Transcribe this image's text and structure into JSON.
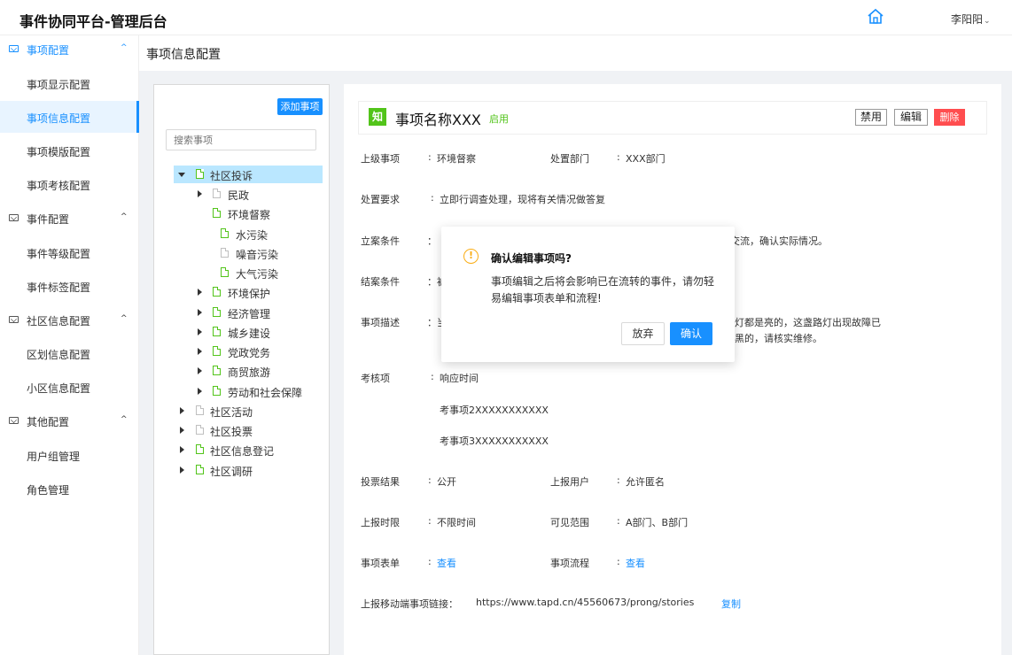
{
  "header": {
    "title": "事件协同平台-管理后台",
    "user": "李阳阳"
  },
  "sidebar": {
    "groups": [
      {
        "label": "事项配置",
        "items": [
          "事项显示配置",
          "事项信息配置",
          "事项模版配置",
          "事项考核配置"
        ]
      },
      {
        "label": "事件配置",
        "items": [
          "事件等级配置",
          "事件标签配置"
        ]
      },
      {
        "label": "社区信息配置",
        "items": [
          "区划信息配置",
          "小区信息配置"
        ]
      },
      {
        "label": "其他配置",
        "items": [
          "用户组管理",
          "角色管理"
        ]
      }
    ],
    "active_item": "事项信息配置"
  },
  "page": {
    "title": "事项信息配置"
  },
  "tree": {
    "add_button": "添加事项",
    "search_placeholder": "搜索事项",
    "nodes": [
      "社区投诉",
      "民政",
      "环境督察",
      "水污染",
      "噪音污染",
      "大气污染",
      "环境保护",
      "经济管理",
      "城乡建设",
      "党政党务",
      "商贸旅游",
      "劳动和社会保障",
      "社区活动",
      "社区投票",
      "社区信息登记",
      "社区调研"
    ]
  },
  "detail": {
    "badge": "知",
    "name": "事项名称XXX",
    "status": "启用",
    "buttons": {
      "disable": "禁用",
      "edit": "编辑",
      "delete": "删除"
    },
    "colon": ":",
    "labels": {
      "parent": "上级事项",
      "dept": "处置部门",
      "requirement": "处置要求",
      "filing": "立案条件",
      "closing": "结案条件",
      "description": "事项描述",
      "assessment": "考核项",
      "vote": "投票结果",
      "reporter": "上报用户",
      "time_limit": "上报时限",
      "visibility": "可见范围",
      "form": "事项表单",
      "flow": "事项流程",
      "mobile_link": "上报移动端事项链接："
    },
    "values": {
      "parent": "环境督察",
      "dept": "XXX部门",
      "requirement": "立即行调查处理，现将有关情况做答复",
      "filing_tail": "交流，确认实际情况。",
      "filing_head": "：",
      "closing_head": "：被",
      "desc_head": "：当",
      "desc_tail_1": "路灯都是亮的，这盏路灯出现故障已",
      "desc_tail_2": "嘛黑的，请核实维修。",
      "assessment": [
        "响应时间",
        "考事项2XXXXXXXXXXX",
        "考事项3XXXXXXXXXXX"
      ],
      "vote": "公开",
      "reporter": "允许匿名",
      "time_limit": "不限时间",
      "visibility": "A部门、B部门",
      "form_link": "查看",
      "flow_link": "查看",
      "mobile_url": "https://www.tapd.cn/45560673/prong/stories",
      "copy": "复制"
    }
  },
  "modal": {
    "title": "确认编辑事项吗?",
    "body": "事项编辑之后将会影响已在流转的事件，请勿轻易编辑事项表单和流程!",
    "cancel": "放弃",
    "ok": "确认"
  },
  "colors": {
    "accent": "#1890ff",
    "success": "#52c41a",
    "danger": "#ff4d4f",
    "warning": "#faad14"
  }
}
